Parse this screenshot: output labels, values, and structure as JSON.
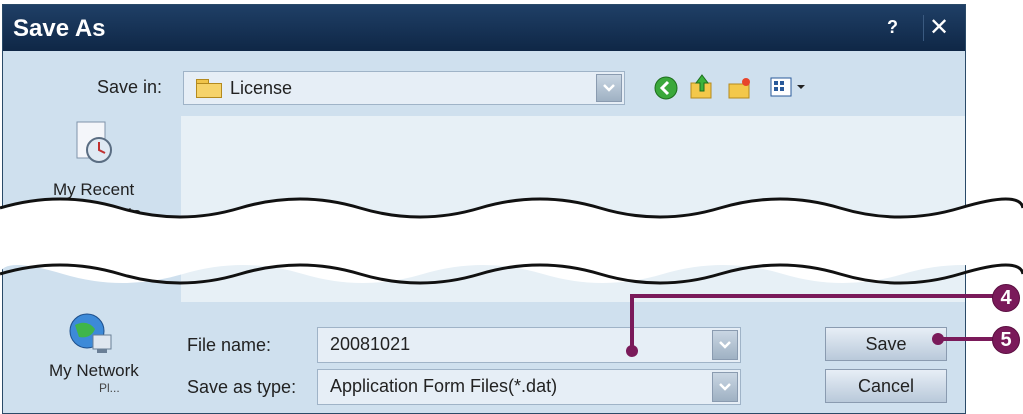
{
  "window": {
    "title": "Save As",
    "help_label": "?",
    "close_label": "✕"
  },
  "save_in": {
    "label": "Save in:",
    "value": "License"
  },
  "toolbar": {
    "icons": [
      "back-icon",
      "up-folder-icon",
      "new-folder-icon",
      "view-menu-icon"
    ]
  },
  "places": [
    {
      "icon": "recent-documents-icon",
      "label_line1": "My Recent",
      "label_line2": "Documents"
    },
    {
      "icon": "network-icon",
      "label_line1": "My Network",
      "label_line2": "Pl..."
    }
  ],
  "file_name": {
    "label": "File name:",
    "value": "20081021"
  },
  "save_type": {
    "label": "Save as type:",
    "value": "Application Form Files(*.dat)"
  },
  "buttons": {
    "save": "Save",
    "cancel": "Cancel"
  },
  "callouts": {
    "file_name": "4",
    "save": "5"
  },
  "colors": {
    "title_bar": "#1f3f66",
    "dialog_bg": "#cfe0ee",
    "list_bg": "#e7f0f6",
    "callout": "#7a1a5a"
  }
}
